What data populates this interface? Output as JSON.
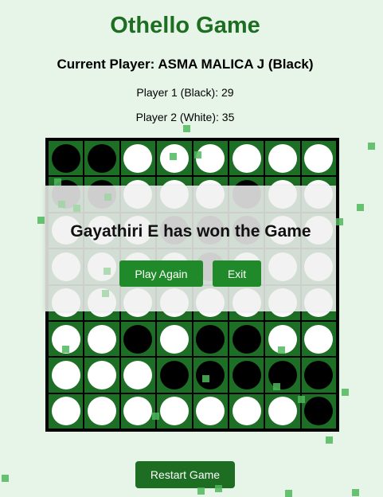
{
  "header": {
    "title": "Othello Game",
    "current_player": "Current Player: ASMA MALICA J (Black)",
    "player1_score": "Player 1 (Black): 29",
    "player2_score": "Player 2 (White): 35"
  },
  "board": {
    "rows": [
      [
        "black",
        "black",
        "white",
        "white",
        "white",
        "white",
        "white",
        "white"
      ],
      [
        "black",
        "black",
        "white",
        "white",
        "white",
        "black",
        "white",
        "white"
      ],
      [
        "white",
        "white",
        "white",
        "black",
        "black",
        "black",
        "white",
        "white"
      ],
      [
        "white",
        "white",
        "white",
        "white",
        "black",
        "white",
        "white",
        "white"
      ],
      [
        "white",
        "white",
        "white",
        "white",
        "white",
        "white",
        "white",
        "white"
      ],
      [
        "white",
        "white",
        "black",
        "white",
        "black",
        "black",
        "white",
        "white"
      ],
      [
        "white",
        "white",
        "white",
        "black",
        "black",
        "black",
        "black",
        "black"
      ],
      [
        "white",
        "white",
        "white",
        "white",
        "white",
        "white",
        "white",
        "black"
      ]
    ]
  },
  "game_over": {
    "message": "Gayathiri E has won the Game",
    "play_again_label": "Play Again",
    "exit_label": "Exit"
  },
  "footer": {
    "restart_label": "Restart Game"
  },
  "colors": {
    "accent": "#1d6e22",
    "board_green": "#1e6f26",
    "background": "#e7f4e8"
  }
}
